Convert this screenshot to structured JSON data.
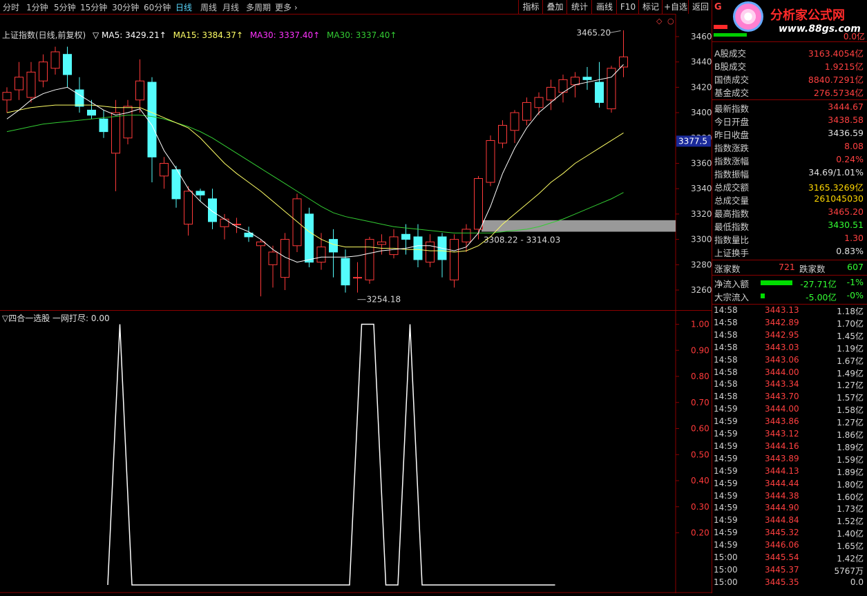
{
  "toolbar": {
    "periods": [
      "分时",
      "1分钟",
      "5分钟",
      "15分钟",
      "30分钟",
      "60分钟",
      "日线",
      "周线",
      "月线",
      "多周期",
      "更多 ›"
    ],
    "buttons": [
      "指标",
      "叠加",
      "统计",
      "画线",
      "F10",
      "标记",
      "+自选",
      "返回"
    ]
  },
  "legend": {
    "title": "上证指数(日线,前复权)",
    "ma5": "▽ MA5: 3429.21↑",
    "ma15": "MA15: 3384.37↑",
    "ma30a": "MA30: 3337.40↑",
    "ma30b": "MA30: 3337.40↑"
  },
  "price_axis": {
    "labels": [
      "3460",
      "3440",
      "3420",
      "3400",
      "3380",
      "3360",
      "3340",
      "3320",
      "3300",
      "3280",
      "3260"
    ],
    "current": "3377.5"
  },
  "annotations": {
    "high": "3465.20",
    "low": "3254.18",
    "box": "3308.22 - 3314.03"
  },
  "indicator": {
    "title": "▽四合一选股  一网打尽: 0.00",
    "axis": [
      "1.00",
      "0.90",
      "0.80",
      "0.70",
      "0.60",
      "0.50",
      "0.40",
      "0.30",
      "0.20"
    ]
  },
  "colors": {
    "up": "#ff3a3a",
    "down": "#54fcfc",
    "ma5": "#ffffff",
    "ma15": "#ffff66",
    "ma30": "#33cc33",
    "border": "#8b0000"
  },
  "chart_data": [
    {
      "type": "candlestick",
      "ylim": [
        3250,
        3470
      ],
      "candles": [
        [
          3410,
          3416,
          3400,
          3420
        ],
        [
          3418,
          3428,
          3410,
          3440
        ],
        [
          3412,
          3432,
          3408,
          3440
        ],
        [
          3425,
          3440,
          3420,
          3446
        ],
        [
          3435,
          3448,
          3430,
          3452
        ],
        [
          3446,
          3430,
          3420,
          3452
        ],
        [
          3418,
          3405,
          3400,
          3428
        ],
        [
          3402,
          3398,
          3395,
          3410
        ],
        [
          3395,
          3385,
          3380,
          3402
        ],
        [
          3368,
          3400,
          3338,
          3410
        ],
        [
          3380,
          3405,
          3375,
          3410
        ],
        [
          3410,
          3425,
          3400,
          3442
        ],
        [
          3424,
          3365,
          3345,
          3428
        ],
        [
          3350,
          3360,
          3340,
          3365
        ],
        [
          3355,
          3332,
          3325,
          3358
        ],
        [
          3312,
          3338,
          3303,
          3342
        ],
        [
          3338,
          3335,
          3330,
          3340
        ],
        [
          3332,
          3314,
          3308,
          3340
        ],
        [
          3310,
          3316,
          3300,
          3320
        ],
        [
          3312,
          3312,
          3305,
          3317
        ],
        [
          3305,
          3302,
          3298,
          3310
        ],
        [
          3295,
          3298,
          3255,
          3300
        ],
        [
          3280,
          3290,
          3262,
          3295
        ],
        [
          3270,
          3300,
          3260,
          3305
        ],
        [
          3295,
          3332,
          3290,
          3336
        ],
        [
          3320,
          3282,
          3278,
          3325
        ],
        [
          3282,
          3294,
          3276,
          3305
        ],
        [
          3300,
          3290,
          3270,
          3308
        ],
        [
          3285,
          3264,
          3258,
          3292
        ],
        [
          3270,
          3270,
          3258,
          3282
        ],
        [
          3268,
          3300,
          3265,
          3302
        ],
        [
          3296,
          3298,
          3288,
          3304
        ],
        [
          3288,
          3302,
          3285,
          3308
        ],
        [
          3304,
          3300,
          3288,
          3312
        ],
        [
          3302,
          3284,
          3278,
          3312
        ],
        [
          3282,
          3298,
          3278,
          3304
        ],
        [
          3302,
          3284,
          3270,
          3305
        ],
        [
          3268,
          3300,
          3262,
          3304
        ],
        [
          3298,
          3308,
          3290,
          3312
        ],
        [
          3308,
          3348,
          3300,
          3350
        ],
        [
          3345,
          3378,
          3342,
          3382
        ],
        [
          3376,
          3390,
          3372,
          3394
        ],
        [
          3386,
          3400,
          3376,
          3402
        ],
        [
          3394,
          3408,
          3390,
          3412
        ],
        [
          3404,
          3412,
          3398,
          3416
        ],
        [
          3410,
          3420,
          3402,
          3426
        ],
        [
          3416,
          3426,
          3408,
          3430
        ],
        [
          3422,
          3428,
          3412,
          3432
        ],
        [
          3428,
          3426,
          3418,
          3436
        ],
        [
          3424,
          3408,
          3404,
          3440
        ],
        [
          3403,
          3435,
          3400,
          3437
        ],
        [
          3436,
          3444,
          3428,
          3465
        ]
      ],
      "ma5": [
        3395,
        3402,
        3410,
        3415,
        3418,
        3420,
        3414,
        3408,
        3402,
        3398,
        3400,
        3403,
        3390,
        3370,
        3356,
        3340,
        3330,
        3322,
        3316,
        3310,
        3306,
        3300,
        3292,
        3286,
        3282,
        3284,
        3286,
        3286,
        3286,
        3287,
        3289,
        3291,
        3292,
        3293,
        3295,
        3295,
        3293,
        3291,
        3294,
        3305,
        3326,
        3352,
        3372,
        3388,
        3400,
        3408,
        3416,
        3422,
        3424,
        3426,
        3428,
        3438
      ],
      "ma15": [
        3400,
        3402,
        3404,
        3405,
        3406,
        3406,
        3406,
        3406,
        3405,
        3404,
        3404,
        3404,
        3400,
        3396,
        3392,
        3388,
        3380,
        3370,
        3360,
        3352,
        3345,
        3338,
        3330,
        3322,
        3314,
        3306,
        3300,
        3296,
        3294,
        3294,
        3294,
        3293,
        3293,
        3292,
        3292,
        3291,
        3291,
        3290,
        3291,
        3295,
        3302,
        3312,
        3320,
        3328,
        3336,
        3345,
        3352,
        3360,
        3366,
        3372,
        3378,
        3384
      ],
      "ma30": [
        3385,
        3387,
        3389,
        3391,
        3392,
        3393,
        3394,
        3395,
        3396,
        3397,
        3398,
        3398,
        3397,
        3395,
        3392,
        3389,
        3385,
        3380,
        3374,
        3368,
        3362,
        3356,
        3350,
        3344,
        3338,
        3332,
        3326,
        3321,
        3318,
        3316,
        3314,
        3312,
        3310,
        3309,
        3308,
        3307,
        3306,
        3305,
        3305,
        3305,
        3305,
        3306,
        3307,
        3308,
        3310,
        3313,
        3316,
        3320,
        3324,
        3328,
        3332,
        3337
      ]
    },
    {
      "type": "line",
      "ylim": [
        0,
        1
      ],
      "values": [
        0,
        0,
        0,
        0,
        0,
        0,
        0,
        0,
        0,
        1,
        0,
        0,
        0,
        0,
        0,
        0,
        0,
        0,
        0,
        0,
        0,
        0,
        0,
        0,
        0,
        0,
        0,
        0,
        0,
        1,
        1,
        0,
        0,
        1,
        0,
        0,
        0,
        0,
        0,
        0,
        0,
        0,
        0,
        0,
        0,
        0,
        0,
        0,
        0,
        0,
        0,
        0
      ]
    }
  ],
  "sidebar": {
    "logo": "分析家公式网",
    "logo_url": "www.88gs.com",
    "top_value": "0.0亿",
    "stats1": [
      {
        "label": "A股成交",
        "value": "3163.4054亿",
        "color": "#ff4040"
      },
      {
        "label": "B股成交",
        "value": "1.9215亿",
        "color": "#ff4040"
      },
      {
        "label": "国债成交",
        "value": "8840.7291亿",
        "color": "#ff4040"
      },
      {
        "label": "基金成交",
        "value": "276.5734亿",
        "color": "#ff4040"
      }
    ],
    "stats2": [
      {
        "label": "最新指数",
        "value": "3444.67",
        "color": "#ff4040"
      },
      {
        "label": "今日开盘",
        "value": "3438.58",
        "color": "#ff4040"
      },
      {
        "label": "昨日收盘",
        "value": "3436.59",
        "color": "#e0e0e0"
      },
      {
        "label": "指数涨跌",
        "value": "8.08",
        "color": "#ff4040"
      },
      {
        "label": "指数涨幅",
        "value": "0.24%",
        "color": "#ff4040"
      },
      {
        "label": "指数振幅",
        "value": "34.69/1.01%",
        "color": "#e0e0e0"
      },
      {
        "label": "总成交额",
        "value": "3165.3269亿",
        "color": "#ffd700"
      },
      {
        "label": "总成交量",
        "value": "261045030",
        "color": "#ffd700"
      },
      {
        "label": "最高指数",
        "value": "3465.20",
        "color": "#ff4040"
      },
      {
        "label": "最低指数",
        "value": "3430.51",
        "color": "#33ff33"
      },
      {
        "label": "指数量比",
        "value": "1.30",
        "color": "#ff4040"
      },
      {
        "label": "上证换手",
        "value": "0.83%",
        "color": "#e0e0e0"
      }
    ],
    "updown": {
      "up_label": "涨家数",
      "up_value": "721",
      "down_label": "跌家数",
      "down_value": "607"
    },
    "flows": [
      {
        "label": "净流入额",
        "value": "-27.71亿",
        "pct": "-1%"
      },
      {
        "label": "大宗流入",
        "value": "-5.00亿",
        "pct": "-0%"
      }
    ],
    "ticks": [
      [
        "14:58",
        "3443.13",
        "1.18亿"
      ],
      [
        "14:58",
        "3442.89",
        "1.70亿"
      ],
      [
        "14:58",
        "3442.95",
        "1.45亿"
      ],
      [
        "14:58",
        "3443.03",
        "1.19亿"
      ],
      [
        "14:58",
        "3443.06",
        "1.67亿"
      ],
      [
        "14:58",
        "3444.00",
        "1.49亿"
      ],
      [
        "14:58",
        "3443.34",
        "1.27亿"
      ],
      [
        "14:58",
        "3443.70",
        "1.57亿"
      ],
      [
        "14:59",
        "3444.00",
        "1.58亿"
      ],
      [
        "14:59",
        "3443.86",
        "1.27亿"
      ],
      [
        "14:59",
        "3443.12",
        "1.86亿"
      ],
      [
        "14:59",
        "3444.16",
        "1.89亿"
      ],
      [
        "14:59",
        "3443.89",
        "1.59亿"
      ],
      [
        "14:59",
        "3444.13",
        "1.89亿"
      ],
      [
        "14:59",
        "3444.44",
        "1.80亿"
      ],
      [
        "14:59",
        "3444.38",
        "1.60亿"
      ],
      [
        "14:59",
        "3444.90",
        "1.73亿"
      ],
      [
        "14:59",
        "3444.84",
        "1.52亿"
      ],
      [
        "14:59",
        "3445.32",
        "1.40亿"
      ],
      [
        "14:59",
        "3446.06",
        "1.65亿"
      ],
      [
        "15:00",
        "3445.54",
        "1.42亿"
      ],
      [
        "15:00",
        "3445.37",
        "5767万"
      ],
      [
        "15:00",
        "3445.35",
        "0.0"
      ]
    ]
  }
}
